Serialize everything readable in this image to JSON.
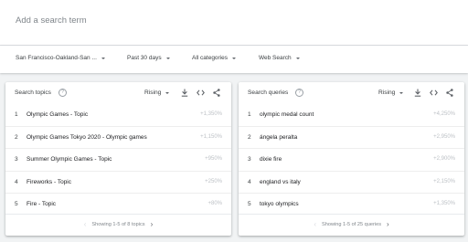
{
  "search": {
    "placeholder": "Add a search term"
  },
  "filters": {
    "location": "San Francisco-Oakland-San ...",
    "time_range": "Past 30 days",
    "category": "All categories",
    "property": "Web Search"
  },
  "topics_card": {
    "title": "Search topics",
    "mode": "Rising",
    "rows": [
      {
        "rank": "1",
        "label": "Olympic Games - Topic",
        "value": "+1,350%"
      },
      {
        "rank": "2",
        "label": "Olympic Games Tokyo 2020 - Olympic games",
        "value": "+1,150%"
      },
      {
        "rank": "3",
        "label": "Summer Olympic Games - Topic",
        "value": "+950%"
      },
      {
        "rank": "4",
        "label": "Fireworks - Topic",
        "value": "+250%"
      },
      {
        "rank": "5",
        "label": "Fire - Topic",
        "value": "+80%"
      }
    ],
    "pager": "Showing 1-5 of 8 topics"
  },
  "queries_card": {
    "title": "Search queries",
    "mode": "Rising",
    "rows": [
      {
        "rank": "1",
        "label": "olympic medal count",
        "value": "+4,250%"
      },
      {
        "rank": "2",
        "label": "ángela peralta",
        "value": "+2,950%"
      },
      {
        "rank": "3",
        "label": "dixie fire",
        "value": "+2,900%"
      },
      {
        "rank": "4",
        "label": "england vs italy",
        "value": "+2,150%"
      },
      {
        "rank": "5",
        "label": "tokyo olympics",
        "value": "+1,350%"
      }
    ],
    "pager": "Showing 1-5 of 25 queries"
  },
  "icons": {
    "help": "help-circle-icon",
    "download": "download-icon",
    "embed": "embed-code-icon",
    "share": "share-icon",
    "prev": "chevron-left-icon",
    "next": "chevron-right-icon"
  },
  "colors": {
    "text": "#202124",
    "muted": "#80868b",
    "value": "#bdc1c6",
    "background": "#f1f3f4"
  }
}
